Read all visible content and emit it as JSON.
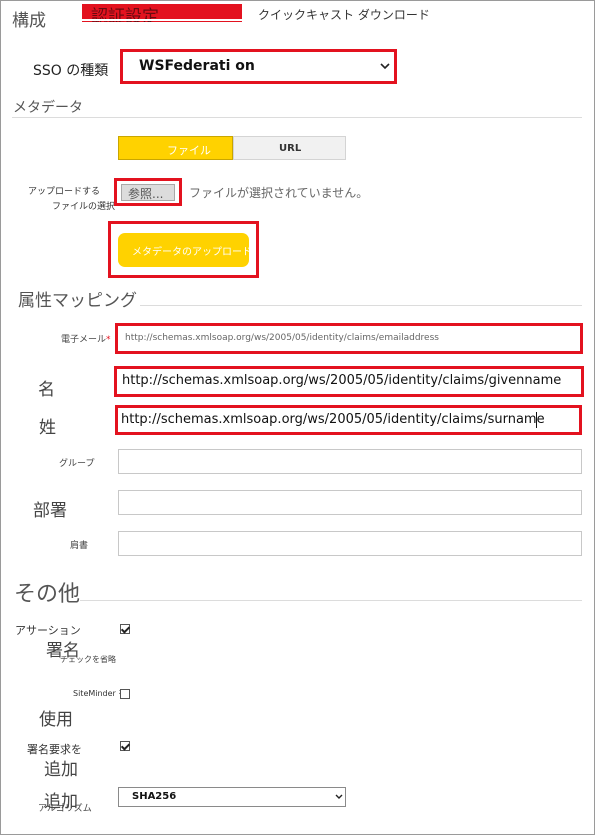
{
  "tabs": [
    {
      "label": "構成"
    },
    {
      "label": "認証設定"
    },
    {
      "label": "クイックキャスト ダウンロード"
    }
  ],
  "sso": {
    "label": "SSO の種類",
    "value": "WSFederati on"
  },
  "metadata": {
    "section_title": "メタデータ",
    "toggle_file": "ファイル",
    "toggle_url": "URL",
    "upload_label_line1": "アップロードする",
    "upload_label_line2": "ファイルの選択",
    "browse_label": "参照...",
    "no_file_text": "ファイルが選択されていません。",
    "upload_button": "メタデータのアップロード"
  },
  "attributes": {
    "section_title": "属性マッピング",
    "email_label": "電子メール",
    "email_value": "http://schemas.xmlsoap.org/ws/2005/05/identity/claims/emailaddress",
    "firstname_label": "名",
    "firstname_value": "http://schemas.xmlsoap.org/ws/2005/05/identity/claims/givenname",
    "lastname_label": "姓",
    "lastname_value": "http://schemas.xmlsoap.org/ws/2005/05/identity/claims/surname",
    "group_label": "グループ",
    "group_value": "",
    "department_label": "部署",
    "department_value": "",
    "title_label": "肩書",
    "title_value": ""
  },
  "other": {
    "section_title": "その他",
    "assertion_label_line1": "アサーション",
    "assertion_label_line2": "署名",
    "assertion_label_line3": "チェックを省略",
    "assertion_checked": true,
    "siteminder_label": "SiteMinder を",
    "siteminder_label_line2": "使用",
    "siteminder_checked": false,
    "signreq_label_line1": "署名要求を",
    "signreq_label_line2": "追加",
    "signreq_checked": true,
    "algo_label_line1": "追加",
    "algo_label_line2": "アルゴリズム",
    "algo_value": "SHA256"
  },
  "colors": {
    "accent_yellow": "#ffd200",
    "highlight_red": "#e3121f"
  }
}
